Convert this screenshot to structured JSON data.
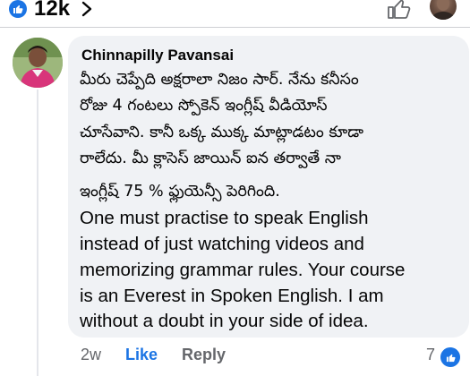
{
  "reactions": {
    "count": "12k",
    "like_icon": "like-thumb-icon",
    "accent_color": "#1b74e4"
  },
  "comment": {
    "author": "Chinnapilly Pavansai",
    "telugu_lines": [
      "మీరు చెప్పేది అక్షరాలా నిజం సార్. నేను కనీసం",
      "రోజు 4 గంటలు స్పోకెన్ ఇంగ్లీష్ వీడియోస్",
      "చూసేవాని. కానీ ఒక్క ముక్క మాట్లాడటం కూడా",
      "రాలేదు. మీ క్లాసెస్ జాయిన్ ఐన తర్వాతే నా",
      "ఇంగ్లీష్ 75 % ఫ్లుయెన్సీ పెరిగింది."
    ],
    "english_lines": [
      "One must practise to speak English",
      "instead of just watching videos and",
      "memorizing grammar rules. Your course",
      "is an Everest in Spoken English. I am",
      "without a doubt in your side of idea."
    ]
  },
  "actions": {
    "time": "2w",
    "like": "Like",
    "reply": "Reply",
    "reaction_count": "7"
  }
}
